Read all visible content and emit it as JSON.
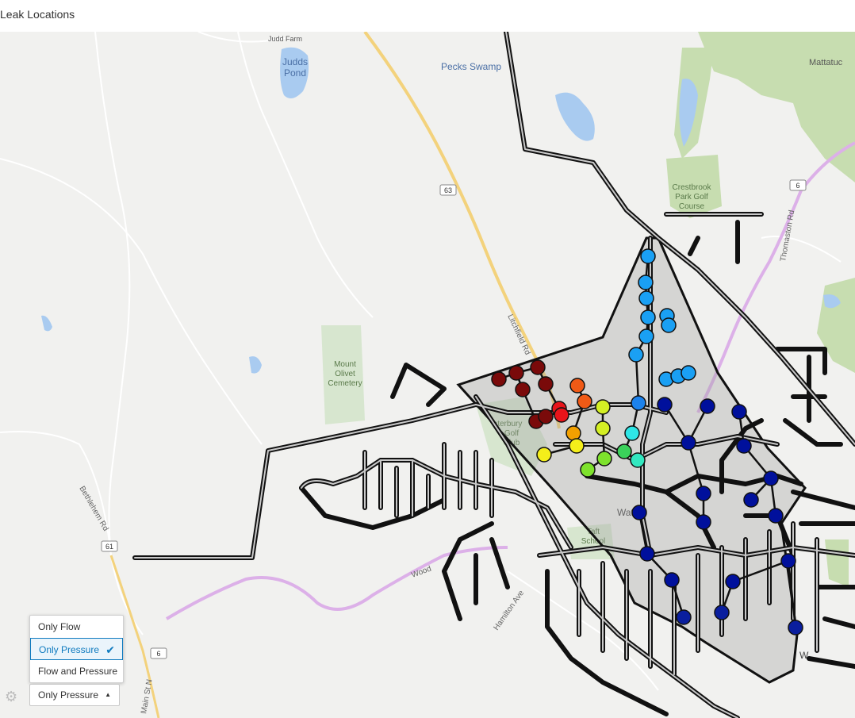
{
  "page": {
    "title": "Leak Locations"
  },
  "map": {
    "labels": {
      "judds_pond": [
        "Judds",
        "Pond"
      ],
      "judd_farm": "Judd Farm",
      "pecks_swamp": "Pecks Swamp",
      "mattatuck": "Mattatuc",
      "crestbrook": [
        "Crestbrook",
        "Park Golf",
        "Course"
      ],
      "mount_olivet": [
        "Mount",
        "Olivet",
        "Cemetery"
      ],
      "litchfield_rd": "Litchfield Rd",
      "thomaston_rd": "Thomaston Rd",
      "bethlehem_rd": "Bethlehem Rd",
      "hamilton_ave": "Hamilton Ave",
      "woodbury_rd": "Wood",
      "main_st": "Main St N",
      "waterbury_golf": [
        "aterbury",
        "Golf",
        "Club"
      ],
      "taft_school": [
        "Taft",
        "School"
      ],
      "watertown": "Wat",
      "watertown2": "W"
    },
    "shields": {
      "r63": "63",
      "r6a": "6",
      "r6b": "6",
      "r61": "61"
    },
    "colors": {
      "dark_red": "#7a0a0a",
      "red": "#e8141a",
      "orange": "#f05a16",
      "orange2": "#f2a000",
      "yellow": "#f4ee1a",
      "yellow_green": "#d4ef24",
      "green": "#7ee22c",
      "green2": "#3ad15a",
      "teal": "#32e8c0",
      "cyan": "#2ee6e6",
      "sky": "#1aa0f4",
      "blue": "#1c82ec",
      "navy": "#00109c",
      "navy2": "#0a1e9e"
    }
  },
  "filter_menu": {
    "options": [
      "Only Flow",
      "Only Pressure",
      "Flow and Pressure"
    ],
    "selected": "Only Pressure"
  },
  "filter_select": {
    "value": "Only Pressure"
  }
}
